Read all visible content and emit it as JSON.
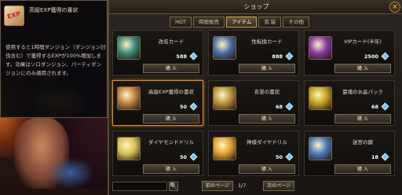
{
  "tooltip": {
    "title": "高級EXP獲得の書状",
    "icon_text": "EXP",
    "description": "使用すると1時間ダンジョン（ダンジョン討伐含む）で獲得するEXPが100%増加します。効果はソロダンジョン、パーティダンジョンにのみ適用されます。"
  },
  "shop": {
    "title": "ショップ",
    "close_label": "×",
    "tabs": [
      {
        "label": "HOT",
        "active": false
      },
      {
        "label": "時限販売",
        "active": false
      },
      {
        "label": "アイテム",
        "active": true
      },
      {
        "label": "衣 装",
        "active": false
      },
      {
        "label": "その他",
        "active": false
      }
    ],
    "items": [
      {
        "name": "改名カード",
        "price": "588",
        "buy": "購 入",
        "icon": "rename-card-icon",
        "color": "#3a8a7a"
      },
      {
        "name": "性転換カード",
        "price": "888",
        "buy": "購 入",
        "icon": "gender-card-icon",
        "color": "#4a6ea8"
      },
      {
        "name": "VIPカード(半年)",
        "price": "2500",
        "buy": "購 入",
        "icon": "vip-card-icon",
        "color": "#8a3aa8"
      },
      {
        "name": "高級EXP獲得の書状",
        "price": "50",
        "buy": "購 入",
        "icon": "exp-scroll-icon",
        "color": "#c08040"
      },
      {
        "name": "名誉の書状",
        "price": "68",
        "buy": "購 入",
        "icon": "honor-scroll-icon",
        "color": "#b8923a"
      },
      {
        "name": "霊魂の水晶パック",
        "price": "68",
        "buy": "購 入",
        "icon": "crystal-pack-icon",
        "color": "#c2a020"
      },
      {
        "name": "ダイヤモンドドリル",
        "price": "50",
        "buy": "購 入",
        "icon": "diamond-drill-icon",
        "color": "#d8c050"
      },
      {
        "name": "神様ダイヤドリル",
        "price": "50",
        "buy": "購 入",
        "icon": "god-drill-icon",
        "color": "#e0a030"
      },
      {
        "name": "迷宮の鍵",
        "price": "18",
        "buy": "購 入",
        "icon": "labyrinth-key-icon",
        "color": "#4a7ac0"
      }
    ],
    "pagination": {
      "prev_label": "前のページ",
      "page_indicator": "1/7",
      "next_label": "次のページ"
    },
    "search_icon": "🔍"
  }
}
